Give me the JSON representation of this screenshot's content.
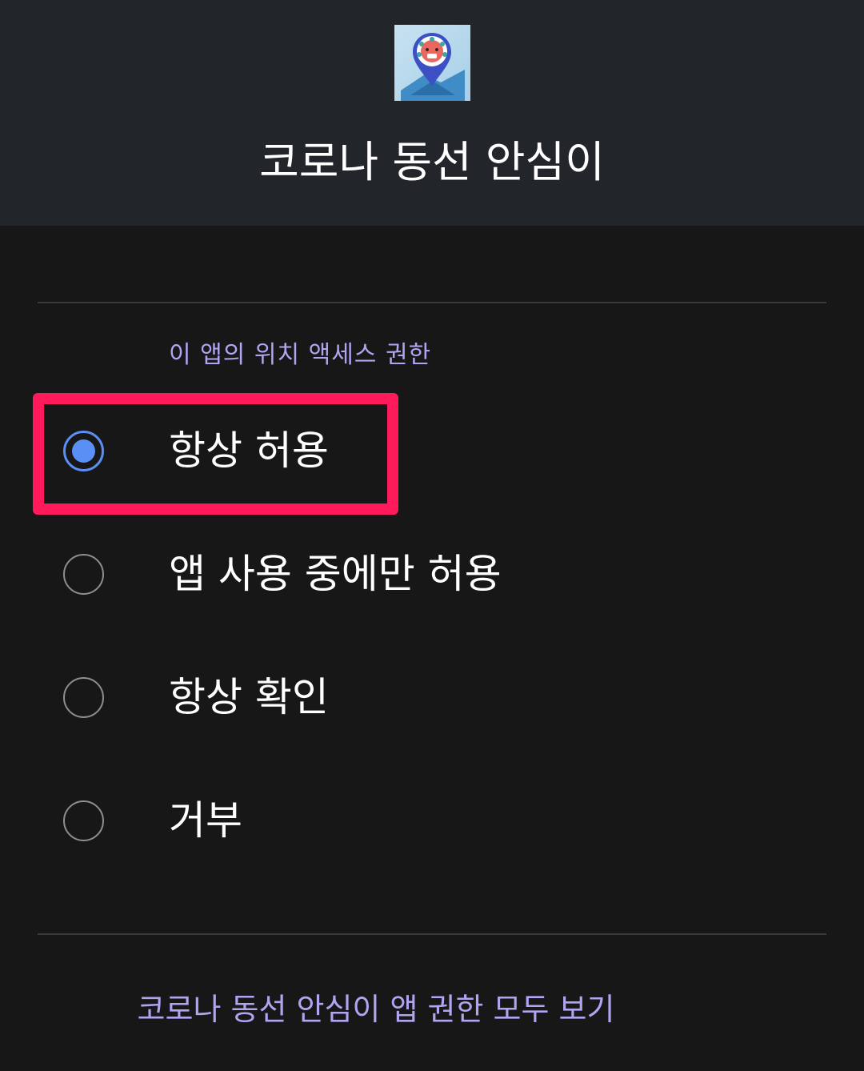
{
  "header": {
    "app_icon": "location-pin-app-icon",
    "app_name": "코로나 동선 안심이"
  },
  "permission": {
    "section_label": "이 앱의 위치 액세스 권한",
    "options": [
      {
        "label": "항상 허용",
        "selected": true
      },
      {
        "label": "앱 사용 중에만 허용",
        "selected": false
      },
      {
        "label": "항상 확인",
        "selected": false
      },
      {
        "label": "거부",
        "selected": false
      }
    ]
  },
  "footer": {
    "link": "코로나 동선 안심이 앱 권한 모두 보기"
  },
  "colors": {
    "accent_text": "#b3a4f2",
    "radio_selected": "#5a8ff5",
    "highlight_border": "#ff1a5c",
    "header_bg": "#22262a",
    "body_bg": "#171717"
  }
}
